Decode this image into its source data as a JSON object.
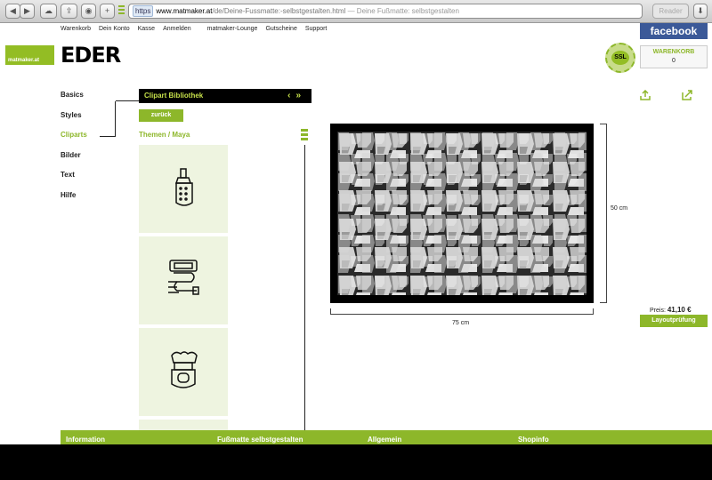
{
  "browser": {
    "https": "https",
    "host": "www.matmaker.at",
    "path": "/de/Deine-Fussmatte:-selbstgestalten.html",
    "title_suffix": "— Deine Fußmatte: selbstgestalten",
    "reader": "Reader"
  },
  "topnav": [
    "Warenkorb",
    "Dein Konto",
    "Kasse",
    "Anmelden",
    "matmaker-Lounge",
    "Gutscheine",
    "Support"
  ],
  "brand": {
    "matmaker": "matmaker.at",
    "eder": "EDER"
  },
  "facebook": "facebook",
  "ssl": "SSL",
  "cart": {
    "label": "WARENKORB",
    "count": "0"
  },
  "menu": [
    "Basics",
    "Styles",
    "Cliparts",
    "Bilder",
    "Text",
    "Hilfe"
  ],
  "clipart": {
    "header": "Clipart Bibliothek",
    "prev": "‹",
    "next": "»",
    "back": "zurück",
    "theme": "Themen / Maya"
  },
  "mat": {
    "height_label": "50 cm",
    "width_label": "75 cm"
  },
  "price": {
    "label": "Preis:",
    "value": "41,10 €"
  },
  "layout_check": "Layoutprüfung",
  "footer": [
    "Information",
    "Fußmatte selbstgestalten",
    "Allgemein",
    "Shopinfo"
  ],
  "colors": {
    "accent": "#8db72a",
    "facebook": "#3b5998"
  }
}
